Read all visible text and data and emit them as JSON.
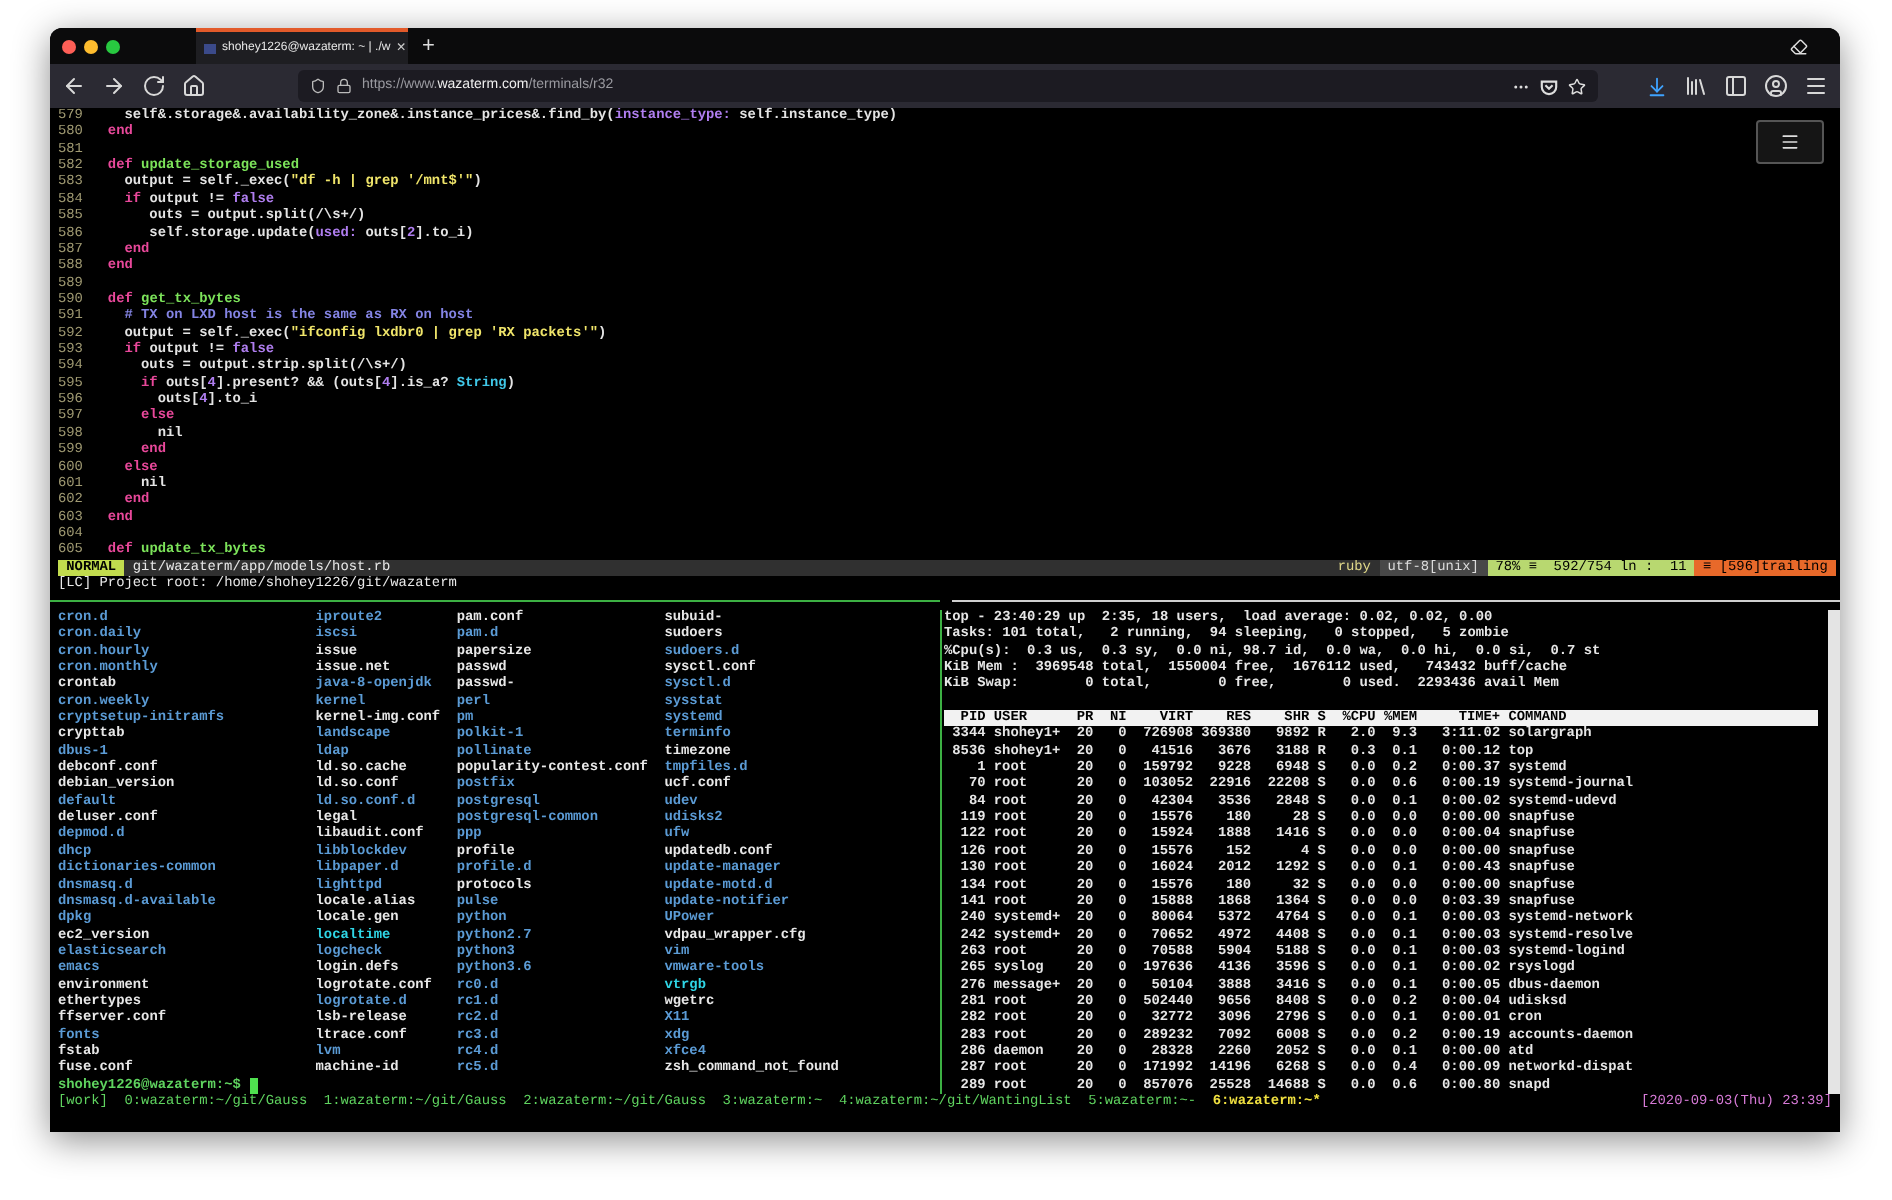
{
  "browser": {
    "tab": {
      "title": "shohey1226@wazaterm: ~ | ./w",
      "close": "×"
    },
    "new_tab": "+",
    "url": {
      "prefix": "https://www.",
      "domain": "wazaterm.com",
      "path": "/terminals/r32"
    }
  },
  "editor": {
    "lines": [
      {
        "number": "579",
        "tokens": [
          {
            "text": "    self&.storage&.availability_zone&.instance_prices&.find_by(",
            "kind": "plain"
          },
          {
            "text": "instance_type:",
            "kind": "symbol"
          },
          {
            "text": " self.instance_type)",
            "kind": "plain"
          }
        ]
      },
      {
        "number": "580",
        "tokens": [
          {
            "text": "  end",
            "kind": "keyword"
          }
        ]
      },
      {
        "number": "581"
      },
      {
        "number": "582",
        "tokens": [
          {
            "text": "  def ",
            "kind": "keyword"
          },
          {
            "text": "update_storage_used",
            "kind": "function"
          }
        ]
      },
      {
        "number": "583",
        "tokens": [
          {
            "text": "    output = self._exec(",
            "kind": "plain"
          },
          {
            "text": "\"df -h | grep '/mnt$'\"",
            "kind": "string"
          },
          {
            "text": ")",
            "kind": "plain"
          }
        ]
      },
      {
        "number": "584",
        "tokens": [
          {
            "text": "    if",
            "kind": "keyword"
          },
          {
            "text": " output != ",
            "kind": "plain"
          },
          {
            "text": "false",
            "kind": "symbol"
          }
        ]
      },
      {
        "number": "585",
        "tokens": [
          {
            "text": "       outs = output.split(/\\s+/)",
            "kind": "plain"
          }
        ]
      },
      {
        "number": "586",
        "tokens": [
          {
            "text": "       self.storage.update(",
            "kind": "plain"
          },
          {
            "text": "used:",
            "kind": "symbol"
          },
          {
            "text": " outs[",
            "kind": "plain"
          },
          {
            "text": "2",
            "kind": "symbol"
          },
          {
            "text": "].to_i)",
            "kind": "plain"
          }
        ]
      },
      {
        "number": "587",
        "tokens": [
          {
            "text": "    end",
            "kind": "keyword"
          }
        ]
      },
      {
        "number": "588",
        "tokens": [
          {
            "text": "  end",
            "kind": "keyword"
          }
        ]
      },
      {
        "number": "589"
      },
      {
        "number": "590",
        "tokens": [
          {
            "text": "  def ",
            "kind": "keyword"
          },
          {
            "text": "get_tx_bytes",
            "kind": "function"
          }
        ]
      },
      {
        "number": "591",
        "tokens": [
          {
            "text": "    # TX on LXD host is the same as RX on host",
            "kind": "comment"
          }
        ]
      },
      {
        "number": "592",
        "tokens": [
          {
            "text": "    output = self._exec(",
            "kind": "plain"
          },
          {
            "text": "\"ifconfig lxdbr0 | grep 'RX packets'\"",
            "kind": "string"
          },
          {
            "text": ")",
            "kind": "plain"
          }
        ]
      },
      {
        "number": "593",
        "tokens": [
          {
            "text": "    if",
            "kind": "keyword"
          },
          {
            "text": " output != ",
            "kind": "plain"
          },
          {
            "text": "false",
            "kind": "symbol"
          }
        ]
      },
      {
        "number": "594",
        "tokens": [
          {
            "text": "      outs = output.strip.split(/\\s+/)",
            "kind": "plain"
          }
        ]
      },
      {
        "number": "595",
        "tokens": [
          {
            "text": "      if",
            "kind": "keyword"
          },
          {
            "text": " outs[",
            "kind": "plain"
          },
          {
            "text": "4",
            "kind": "symbol"
          },
          {
            "text": "].present? && (outs[",
            "kind": "plain"
          },
          {
            "text": "4",
            "kind": "symbol"
          },
          {
            "text": "].is_a? ",
            "kind": "plain"
          },
          {
            "text": "String",
            "kind": "constant"
          },
          {
            "text": ")",
            "kind": "plain"
          }
        ]
      },
      {
        "number": "596",
        "tokens": [
          {
            "text": "        outs[",
            "kind": "plain"
          },
          {
            "text": "4",
            "kind": "symbol"
          },
          {
            "text": "].to_i",
            "kind": "plain"
          }
        ]
      },
      {
        "number": "597",
        "tokens": [
          {
            "text": "      else",
            "kind": "keyword"
          }
        ]
      },
      {
        "number": "598",
        "tokens": [
          {
            "text": "        nil",
            "kind": "plain"
          }
        ]
      },
      {
        "number": "599",
        "tokens": [
          {
            "text": "      end",
            "kind": "keyword"
          }
        ]
      },
      {
        "number": "600",
        "tokens": [
          {
            "text": "    else",
            "kind": "keyword"
          }
        ]
      },
      {
        "number": "601",
        "tokens": [
          {
            "text": "      nil",
            "kind": "plain"
          }
        ]
      },
      {
        "number": "602",
        "tokens": [
          {
            "text": "    end",
            "kind": "keyword"
          }
        ]
      },
      {
        "number": "603",
        "tokens": [
          {
            "text": "  end",
            "kind": "keyword"
          }
        ]
      },
      {
        "number": "604"
      },
      {
        "number": "605",
        "tokens": [
          {
            "text": "  def ",
            "kind": "keyword"
          },
          {
            "text": "update_tx_bytes",
            "kind": "function"
          }
        ]
      }
    ],
    "statusline": {
      "mode": "NORMAL",
      "path": "git/wazaterm/app/models/host.rb",
      "filetype": "ruby",
      "encoding": "utf-8[unix]",
      "position": "78% ≡  592/754 ln :  11",
      "warning": "≡ [596]trailing"
    },
    "message": "[LC] Project root: /home/shohey1226/git/wazaterm"
  },
  "shell": {
    "columns": [
      [
        {
          "name": "cron.d",
          "kind": "dir"
        },
        {
          "name": "cron.daily",
          "kind": "dir"
        },
        {
          "name": "cron.hourly",
          "kind": "dir"
        },
        {
          "name": "cron.monthly",
          "kind": "dir"
        },
        {
          "name": "crontab",
          "kind": "file"
        },
        {
          "name": "cron.weekly",
          "kind": "dir"
        },
        {
          "name": "cryptsetup-initramfs",
          "kind": "dir"
        },
        {
          "name": "crypttab",
          "kind": "file"
        },
        {
          "name": "dbus-1",
          "kind": "dir"
        },
        {
          "name": "debconf.conf",
          "kind": "file"
        },
        {
          "name": "debian_version",
          "kind": "file"
        },
        {
          "name": "default",
          "kind": "dir"
        },
        {
          "name": "deluser.conf",
          "kind": "file"
        },
        {
          "name": "depmod.d",
          "kind": "dir"
        },
        {
          "name": "dhcp",
          "kind": "dir"
        },
        {
          "name": "dictionaries-common",
          "kind": "dir"
        },
        {
          "name": "dnsmasq.d",
          "kind": "dir"
        },
        {
          "name": "dnsmasq.d-available",
          "kind": "dir"
        },
        {
          "name": "dpkg",
          "kind": "dir"
        },
        {
          "name": "ec2_version",
          "kind": "file"
        },
        {
          "name": "elasticsearch",
          "kind": "dir"
        },
        {
          "name": "emacs",
          "kind": "dir"
        },
        {
          "name": "environment",
          "kind": "file"
        },
        {
          "name": "ethertypes",
          "kind": "file"
        },
        {
          "name": "ffserver.conf",
          "kind": "file"
        },
        {
          "name": "fonts",
          "kind": "dir"
        },
        {
          "name": "fstab",
          "kind": "file"
        },
        {
          "name": "fuse.conf",
          "kind": "file"
        }
      ],
      [
        {
          "name": "iproute2",
          "kind": "dir"
        },
        {
          "name": "iscsi",
          "kind": "dir"
        },
        {
          "name": "issue",
          "kind": "file"
        },
        {
          "name": "issue.net",
          "kind": "file"
        },
        {
          "name": "java-8-openjdk",
          "kind": "dir"
        },
        {
          "name": "kernel",
          "kind": "dir"
        },
        {
          "name": "kernel-img.conf",
          "kind": "file"
        },
        {
          "name": "landscape",
          "kind": "dir"
        },
        {
          "name": "ldap",
          "kind": "dir"
        },
        {
          "name": "ld.so.cache",
          "kind": "file"
        },
        {
          "name": "ld.so.conf",
          "kind": "file"
        },
        {
          "name": "ld.so.conf.d",
          "kind": "dir"
        },
        {
          "name": "legal",
          "kind": "file"
        },
        {
          "name": "libaudit.conf",
          "kind": "file"
        },
        {
          "name": "libblockdev",
          "kind": "dir"
        },
        {
          "name": "libpaper.d",
          "kind": "dir"
        },
        {
          "name": "lighttpd",
          "kind": "dir"
        },
        {
          "name": "locale.alias",
          "kind": "file"
        },
        {
          "name": "locale.gen",
          "kind": "file"
        },
        {
          "name": "localtime",
          "kind": "link"
        },
        {
          "name": "logcheck",
          "kind": "dir"
        },
        {
          "name": "login.defs",
          "kind": "file"
        },
        {
          "name": "logrotate.conf",
          "kind": "file"
        },
        {
          "name": "logrotate.d",
          "kind": "dir"
        },
        {
          "name": "lsb-release",
          "kind": "file"
        },
        {
          "name": "ltrace.conf",
          "kind": "file"
        },
        {
          "name": "lvm",
          "kind": "dir"
        },
        {
          "name": "machine-id",
          "kind": "file"
        }
      ],
      [
        {
          "name": "pam.conf",
          "kind": "file"
        },
        {
          "name": "pam.d",
          "kind": "dir"
        },
        {
          "name": "papersize",
          "kind": "file"
        },
        {
          "name": "passwd",
          "kind": "file"
        },
        {
          "name": "passwd-",
          "kind": "file"
        },
        {
          "name": "perl",
          "kind": "dir"
        },
        {
          "name": "pm",
          "kind": "dir"
        },
        {
          "name": "polkit-1",
          "kind": "dir"
        },
        {
          "name": "pollinate",
          "kind": "dir"
        },
        {
          "name": "popularity-contest.conf",
          "kind": "file"
        },
        {
          "name": "postfix",
          "kind": "dir"
        },
        {
          "name": "postgresql",
          "kind": "dir"
        },
        {
          "name": "postgresql-common",
          "kind": "dir"
        },
        {
          "name": "ppp",
          "kind": "dir"
        },
        {
          "name": "profile",
          "kind": "file"
        },
        {
          "name": "profile.d",
          "kind": "dir"
        },
        {
          "name": "protocols",
          "kind": "file"
        },
        {
          "name": "pulse",
          "kind": "dir"
        },
        {
          "name": "python",
          "kind": "dir"
        },
        {
          "name": "python2.7",
          "kind": "dir"
        },
        {
          "name": "python3",
          "kind": "dir"
        },
        {
          "name": "python3.6",
          "kind": "dir"
        },
        {
          "name": "rc0.d",
          "kind": "dir"
        },
        {
          "name": "rc1.d",
          "kind": "dir"
        },
        {
          "name": "rc2.d",
          "kind": "dir"
        },
        {
          "name": "rc3.d",
          "kind": "dir"
        },
        {
          "name": "rc4.d",
          "kind": "dir"
        },
        {
          "name": "rc5.d",
          "kind": "dir"
        }
      ],
      [
        {
          "name": "subuid-",
          "kind": "file"
        },
        {
          "name": "sudoers",
          "kind": "file"
        },
        {
          "name": "sudoers.d",
          "kind": "dir"
        },
        {
          "name": "sysctl.conf",
          "kind": "file"
        },
        {
          "name": "sysctl.d",
          "kind": "dir"
        },
        {
          "name": "sysstat",
          "kind": "dir"
        },
        {
          "name": "systemd",
          "kind": "dir"
        },
        {
          "name": "terminfo",
          "kind": "dir"
        },
        {
          "name": "timezone",
          "kind": "file"
        },
        {
          "name": "tmpfiles.d",
          "kind": "dir"
        },
        {
          "name": "ucf.conf",
          "kind": "file"
        },
        {
          "name": "udev",
          "kind": "dir"
        },
        {
          "name": "udisks2",
          "kind": "dir"
        },
        {
          "name": "ufw",
          "kind": "dir"
        },
        {
          "name": "updatedb.conf",
          "kind": "file"
        },
        {
          "name": "update-manager",
          "kind": "dir"
        },
        {
          "name": "update-motd.d",
          "kind": "dir"
        },
        {
          "name": "update-notifier",
          "kind": "dir"
        },
        {
          "name": "UPower",
          "kind": "dir"
        },
        {
          "name": "vdpau_wrapper.cfg",
          "kind": "file"
        },
        {
          "name": "vim",
          "kind": "dir"
        },
        {
          "name": "vmware-tools",
          "kind": "dir"
        },
        {
          "name": "vtrgb",
          "kind": "link"
        },
        {
          "name": "wgetrc",
          "kind": "file"
        },
        {
          "name": "X11",
          "kind": "dir"
        },
        {
          "name": "xdg",
          "kind": "dir"
        },
        {
          "name": "xfce4",
          "kind": "dir"
        },
        {
          "name": "zsh_command_not_found",
          "kind": "file"
        }
      ]
    ],
    "prompt": "shohey1226@wazaterm:~$"
  },
  "top": {
    "summary": [
      "top - 23:40:29 up  2:35, 18 users,  load average: 0.02, 0.02, 0.00",
      "Tasks: 101 total,   2 running,  94 sleeping,   0 stopped,   5 zombie",
      "%Cpu(s):  0.3 us,  0.3 sy,  0.0 ni, 98.7 id,  0.0 wa,  0.0 hi,  0.0 si,  0.7 st",
      "KiB Mem :  3969548 total,  1550004 free,  1676112 used,   743432 buff/cache",
      "KiB Swap:        0 total,        0 free,        0 used.  2293436 avail Mem"
    ],
    "columns": [
      "PID",
      "USER",
      "PR",
      "NI",
      "VIRT",
      "RES",
      "SHR",
      "S",
      "%CPU",
      "%MEM",
      "TIME+",
      "COMMAND"
    ],
    "rows": [
      [
        "3344",
        "shohey1+",
        "20",
        "0",
        "726908",
        "369380",
        "9892",
        "R",
        "2.0",
        "9.3",
        "3:11.02",
        "solargraph"
      ],
      [
        "8536",
        "shohey1+",
        "20",
        "0",
        "41516",
        "3676",
        "3188",
        "R",
        "0.3",
        "0.1",
        "0:00.12",
        "top"
      ],
      [
        "1",
        "root",
        "20",
        "0",
        "159792",
        "9228",
        "6948",
        "S",
        "0.0",
        "0.2",
        "0:00.37",
        "systemd"
      ],
      [
        "70",
        "root",
        "20",
        "0",
        "103052",
        "22916",
        "22208",
        "S",
        "0.0",
        "0.6",
        "0:00.19",
        "systemd-journal"
      ],
      [
        "84",
        "root",
        "20",
        "0",
        "42304",
        "3536",
        "2848",
        "S",
        "0.0",
        "0.1",
        "0:00.02",
        "systemd-udevd"
      ],
      [
        "119",
        "root",
        "20",
        "0",
        "15576",
        "180",
        "28",
        "S",
        "0.0",
        "0.0",
        "0:00.00",
        "snapfuse"
      ],
      [
        "122",
        "root",
        "20",
        "0",
        "15924",
        "1888",
        "1416",
        "S",
        "0.0",
        "0.0",
        "0:00.04",
        "snapfuse"
      ],
      [
        "126",
        "root",
        "20",
        "0",
        "15576",
        "152",
        "4",
        "S",
        "0.0",
        "0.0",
        "0:00.00",
        "snapfuse"
      ],
      [
        "130",
        "root",
        "20",
        "0",
        "16024",
        "2012",
        "1292",
        "S",
        "0.0",
        "0.1",
        "0:00.43",
        "snapfuse"
      ],
      [
        "134",
        "root",
        "20",
        "0",
        "15576",
        "180",
        "32",
        "S",
        "0.0",
        "0.0",
        "0:00.00",
        "snapfuse"
      ],
      [
        "141",
        "root",
        "20",
        "0",
        "15888",
        "1868",
        "1364",
        "S",
        "0.0",
        "0.0",
        "0:03.39",
        "snapfuse"
      ],
      [
        "240",
        "systemd+",
        "20",
        "0",
        "80064",
        "5372",
        "4764",
        "S",
        "0.0",
        "0.1",
        "0:00.03",
        "systemd-network"
      ],
      [
        "242",
        "systemd+",
        "20",
        "0",
        "70652",
        "4972",
        "4408",
        "S",
        "0.0",
        "0.1",
        "0:00.03",
        "systemd-resolve"
      ],
      [
        "263",
        "root",
        "20",
        "0",
        "70588",
        "5904",
        "5188",
        "S",
        "0.0",
        "0.1",
        "0:00.03",
        "systemd-logind"
      ],
      [
        "265",
        "syslog",
        "20",
        "0",
        "197636",
        "4136",
        "3596",
        "S",
        "0.0",
        "0.1",
        "0:00.02",
        "rsyslogd"
      ],
      [
        "276",
        "message+",
        "20",
        "0",
        "50104",
        "3888",
        "3416",
        "S",
        "0.0",
        "0.1",
        "0:00.05",
        "dbus-daemon"
      ],
      [
        "281",
        "root",
        "20",
        "0",
        "502440",
        "9656",
        "8408",
        "S",
        "0.0",
        "0.2",
        "0:00.04",
        "udisksd"
      ],
      [
        "282",
        "root",
        "20",
        "0",
        "32772",
        "3096",
        "2796",
        "S",
        "0.0",
        "0.1",
        "0:00.01",
        "cron"
      ],
      [
        "283",
        "root",
        "20",
        "0",
        "289232",
        "7092",
        "6008",
        "S",
        "0.0",
        "0.2",
        "0:00.19",
        "accounts-daemon"
      ],
      [
        "286",
        "daemon",
        "20",
        "0",
        "28328",
        "2260",
        "2052",
        "S",
        "0.0",
        "0.1",
        "0:00.00",
        "atd"
      ],
      [
        "287",
        "root",
        "20",
        "0",
        "171992",
        "14196",
        "6268",
        "S",
        "0.0",
        "0.4",
        "0:00.09",
        "networkd-dispat"
      ],
      [
        "289",
        "root",
        "20",
        "0",
        "857076",
        "25528",
        "14688",
        "S",
        "0.0",
        "0.6",
        "0:00.80",
        "snapd"
      ]
    ]
  },
  "tmux": {
    "session": "[work]",
    "windows": [
      {
        "label": "0:wazaterm:~/git/Gauss",
        "selected": false
      },
      {
        "label": "1:wazaterm:~/git/Gauss",
        "selected": false
      },
      {
        "label": "2:wazaterm:~/git/Gauss",
        "selected": false
      },
      {
        "label": "3:wazaterm:~",
        "selected": false
      },
      {
        "label": "4:wazaterm:~/git/WantingList",
        "selected": false
      },
      {
        "label": "5:wazaterm:~-",
        "selected": false
      },
      {
        "label": "6:wazaterm:~*",
        "selected": true
      }
    ],
    "clock": "[2020-09-03(Thu) 23:39]"
  }
}
